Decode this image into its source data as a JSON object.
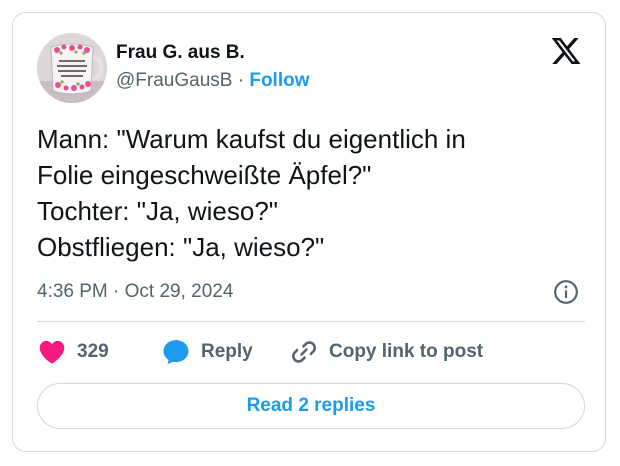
{
  "author": {
    "name": "Frau G. aus B.",
    "handle": "@FrauGausB",
    "separator": "·",
    "follow_label": "Follow",
    "avatar_text": "ICH MUSS NUR KURZ DIE WELT RETTEN"
  },
  "tweet": {
    "lines": [
      "Mann: \"Warum kaufst du eigentlich in",
      "Folie eingeschweißte Äpfel?\"",
      "Tochter: \"Ja, wieso?\"",
      "Obstfliegen: \"Ja, wieso?\""
    ],
    "timestamp": "4:36 PM · Oct 29, 2024"
  },
  "actions": {
    "like_count": "329",
    "reply_label": "Reply",
    "copy_label": "Copy link to post"
  },
  "replies_button": "Read 2 replies",
  "icons": {
    "platform": "x-logo-icon",
    "info": "info-icon",
    "like": "heart-icon",
    "reply": "speech-bubble-icon",
    "copy": "link-icon"
  },
  "colors": {
    "accent": "#1d9bf0",
    "like": "#f91880",
    "text": "#0f1419",
    "secondary": "#536471",
    "border": "#cfd9de"
  }
}
